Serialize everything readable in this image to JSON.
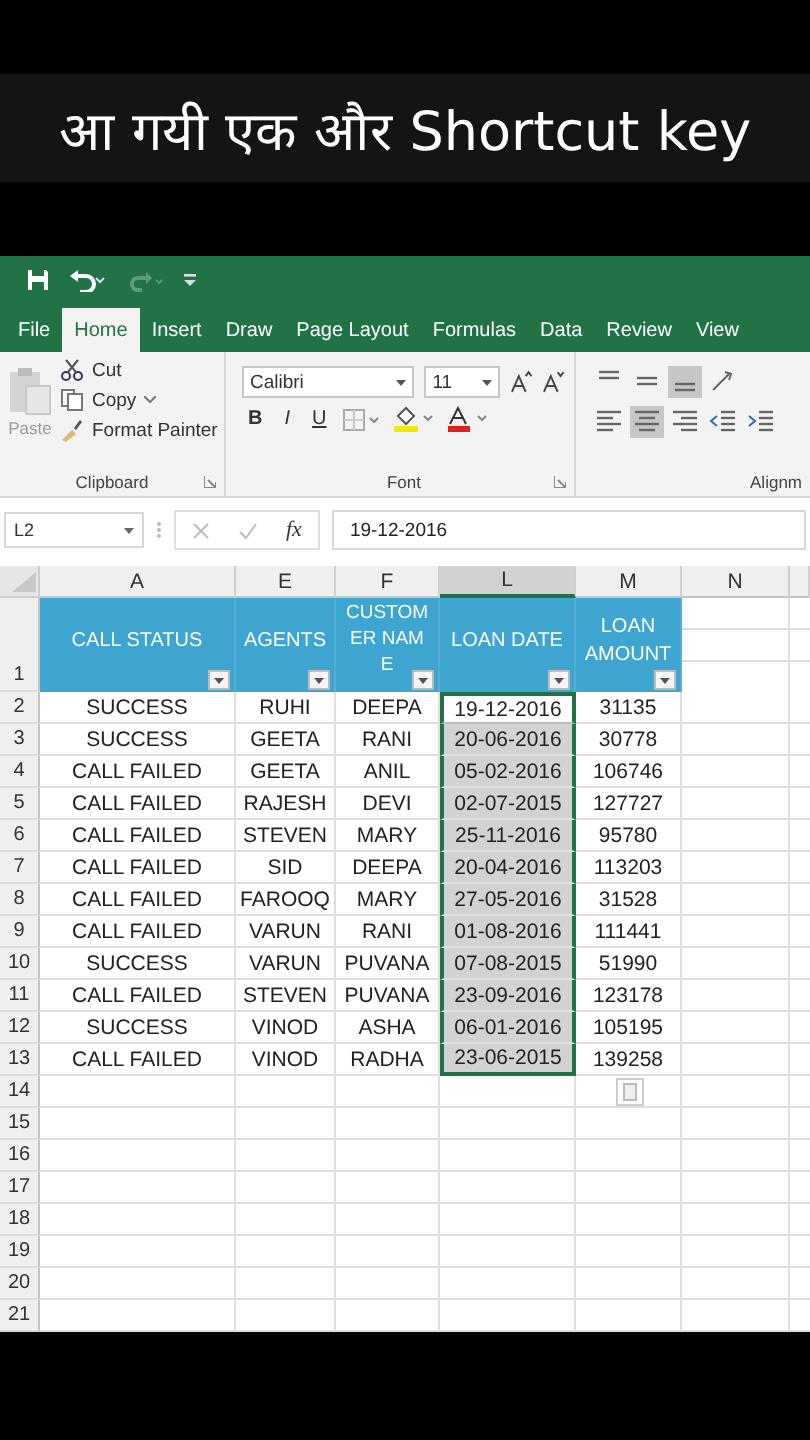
{
  "video_title": "आ गयी एक और Shortcut key",
  "tabs": [
    {
      "label": "File",
      "selected": false
    },
    {
      "label": "Home",
      "selected": true
    },
    {
      "label": "Insert",
      "selected": false
    },
    {
      "label": "Draw",
      "selected": false
    },
    {
      "label": "Page Layout",
      "selected": false
    },
    {
      "label": "Formulas",
      "selected": false
    },
    {
      "label": "Data",
      "selected": false
    },
    {
      "label": "Review",
      "selected": false
    },
    {
      "label": "View",
      "selected": false
    }
  ],
  "clipboard": {
    "paste": "Paste",
    "cut": "Cut",
    "copy": "Copy",
    "format_painter": "Format Painter",
    "label": "Clipboard"
  },
  "font": {
    "family": "Calibri",
    "size": "11",
    "bold": "B",
    "italic": "I",
    "underline": "U",
    "label": "Font"
  },
  "alignment": {
    "label": "Alignm",
    "top_row": [
      {
        "kind": "top",
        "selected": false
      },
      {
        "kind": "middle",
        "selected": false
      },
      {
        "kind": "bottom",
        "selected": true
      },
      {
        "kind": "orient",
        "selected": false
      }
    ],
    "bottom_row": [
      {
        "kind": "left",
        "selected": false
      },
      {
        "kind": "center",
        "selected": true
      },
      {
        "kind": "right",
        "selected": false
      },
      {
        "kind": "outdent",
        "selected": false
      },
      {
        "kind": "indent",
        "selected": false
      }
    ]
  },
  "formula_bar": {
    "name_box": "L2",
    "function_symbol": "fx",
    "value": "19-12-2016"
  },
  "columns": [
    {
      "label": "A",
      "selected": false
    },
    {
      "label": "E",
      "selected": false
    },
    {
      "label": "F",
      "selected": false
    },
    {
      "label": "L",
      "selected": true
    },
    {
      "label": "M",
      "selected": false
    },
    {
      "label": "N",
      "selected": false
    }
  ],
  "header_row": {
    "number": "1",
    "cells": [
      "CALL STATUS",
      "AGENTS",
      "CUSTOMER NAME",
      "LOAN DATE",
      "LOAN AMOUNT"
    ]
  },
  "rows": [
    {
      "number": "2",
      "active": true,
      "cells": [
        "SUCCESS",
        "RUHI",
        "DEEPA",
        "19-12-2016",
        "31135"
      ]
    },
    {
      "number": "3",
      "active": false,
      "cells": [
        "SUCCESS",
        "GEETA",
        "RANI",
        "20-06-2016",
        "30778"
      ]
    },
    {
      "number": "4",
      "active": false,
      "cells": [
        "CALL FAILED",
        "GEETA",
        "ANIL",
        "05-02-2016",
        "106746"
      ]
    },
    {
      "number": "5",
      "active": false,
      "cells": [
        "CALL FAILED",
        "RAJESH",
        "DEVI",
        "02-07-2015",
        "127727"
      ]
    },
    {
      "number": "6",
      "active": false,
      "cells": [
        "CALL FAILED",
        "STEVEN",
        "MARY",
        "25-11-2016",
        "95780"
      ]
    },
    {
      "number": "7",
      "active": false,
      "cells": [
        "CALL FAILED",
        "SID",
        "DEEPA",
        "20-04-2016",
        "113203"
      ]
    },
    {
      "number": "8",
      "active": false,
      "cells": [
        "CALL FAILED",
        "FAROOQ",
        "MARY",
        "27-05-2016",
        "31528"
      ]
    },
    {
      "number": "9",
      "active": false,
      "cells": [
        "CALL FAILED",
        "VARUN",
        "RANI",
        "01-08-2016",
        "111441"
      ]
    },
    {
      "number": "10",
      "active": false,
      "cells": [
        "SUCCESS",
        "VARUN",
        "PUVANA",
        "07-08-2015",
        "51990"
      ]
    },
    {
      "number": "11",
      "active": false,
      "cells": [
        "CALL FAILED",
        "STEVEN",
        "PUVANA",
        "23-09-2016",
        "123178"
      ]
    },
    {
      "number": "12",
      "active": false,
      "cells": [
        "SUCCESS",
        "VINOD",
        "ASHA",
        "06-01-2016",
        "105195"
      ]
    },
    {
      "number": "13",
      "active": false,
      "cells": [
        "CALL FAILED",
        "VINOD",
        "RADHA",
        "23-06-2015",
        "139258"
      ]
    }
  ],
  "empty_rows": [
    "14",
    "15",
    "16",
    "17",
    "18",
    "19",
    "20",
    "21"
  ]
}
